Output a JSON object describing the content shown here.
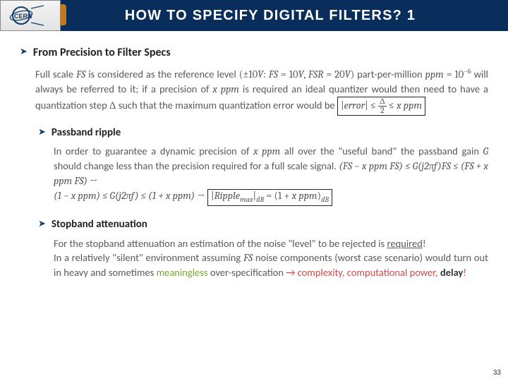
{
  "header": {
    "logo_text": "CERN",
    "title": "HOW TO SPECIFY DIGITAL FILTERS? 1"
  },
  "sec1": {
    "heading": "From Precision to Filter Specs",
    "p_a": "Full scale ",
    "fs": "FS",
    "p_b": " is considered as the reference level ",
    "m1_open": "(±10",
    "m1_v": "V",
    "m1_colon": ": ",
    "m1_fs": "FS",
    "m1_eq1": " = 10",
    "m1_v2": "V",
    "m1_comma": ", ",
    "m1_fsr": "FSR",
    "m1_eq2": " = 20",
    "m1_v3": "V",
    "m1_close": ")",
    "p_c": " part-per-million ",
    "ppm": "ppm",
    "m2_eq": " = 10",
    "m2_exp": "−6",
    "p_d": " will always be referred to it; if a precision of ",
    "xppm": "x ppm",
    "p_e": " is required an ideal quantizer would then need to have a quantization step ",
    "delta": "Δ",
    "p_f": " such that the maximum quantization error would be ",
    "box1_a": "|",
    "box1_err": "error",
    "box1_b": "| ≤ ",
    "box1_num": "Δ",
    "box1_den": "2",
    "box1_c": " ≤ ",
    "box1_d": "x ppm"
  },
  "sec2": {
    "heading": "Passband ripple",
    "p_a": "In order to guarantee a dynamic precision of ",
    "xppm": "x ppm",
    "p_b": " all over the \"useful band\" the passband gain ",
    "g": "G",
    "p_c": " should change less than the precision required for a full scale signal. ",
    "m1": "(FS − x ppm FS) ≤ G(j2πf)FS ≤ (FS + x ppm FS)",
    "arrow1": " →",
    "m2": "(1 − x ppm) ≤ G(j2πf) ≤ (1 + x ppm)",
    "arrow2": " → ",
    "box_a": "|",
    "box_rip": "Ripple",
    "box_sub1": "max",
    "box_b": "|",
    "box_sub2": "dB",
    "box_eq": " = (1 + ",
    "box_x": "x ppm",
    "box_close": ")",
    "box_sub3": "dB"
  },
  "sec3": {
    "heading": "Stopband attenuation",
    "p1_a": "For the stopband attenuation an estimation of the noise \"level\" to be rejected is ",
    "p1_req": "required",
    "p1_b": "!",
    "p2_a": "In a relatively \"silent\" environment assuming ",
    "fs": "FS",
    "p2_b": " noise components (worst case scenario) would turn out in heavy and sometimes ",
    "meaning": "meaningless",
    "p2_c": " over-specification ",
    "arrow": "→",
    "tail_a": " complexity, computational power, ",
    "tail_b": "delay",
    "tail_c": "!"
  },
  "page_number": "33"
}
